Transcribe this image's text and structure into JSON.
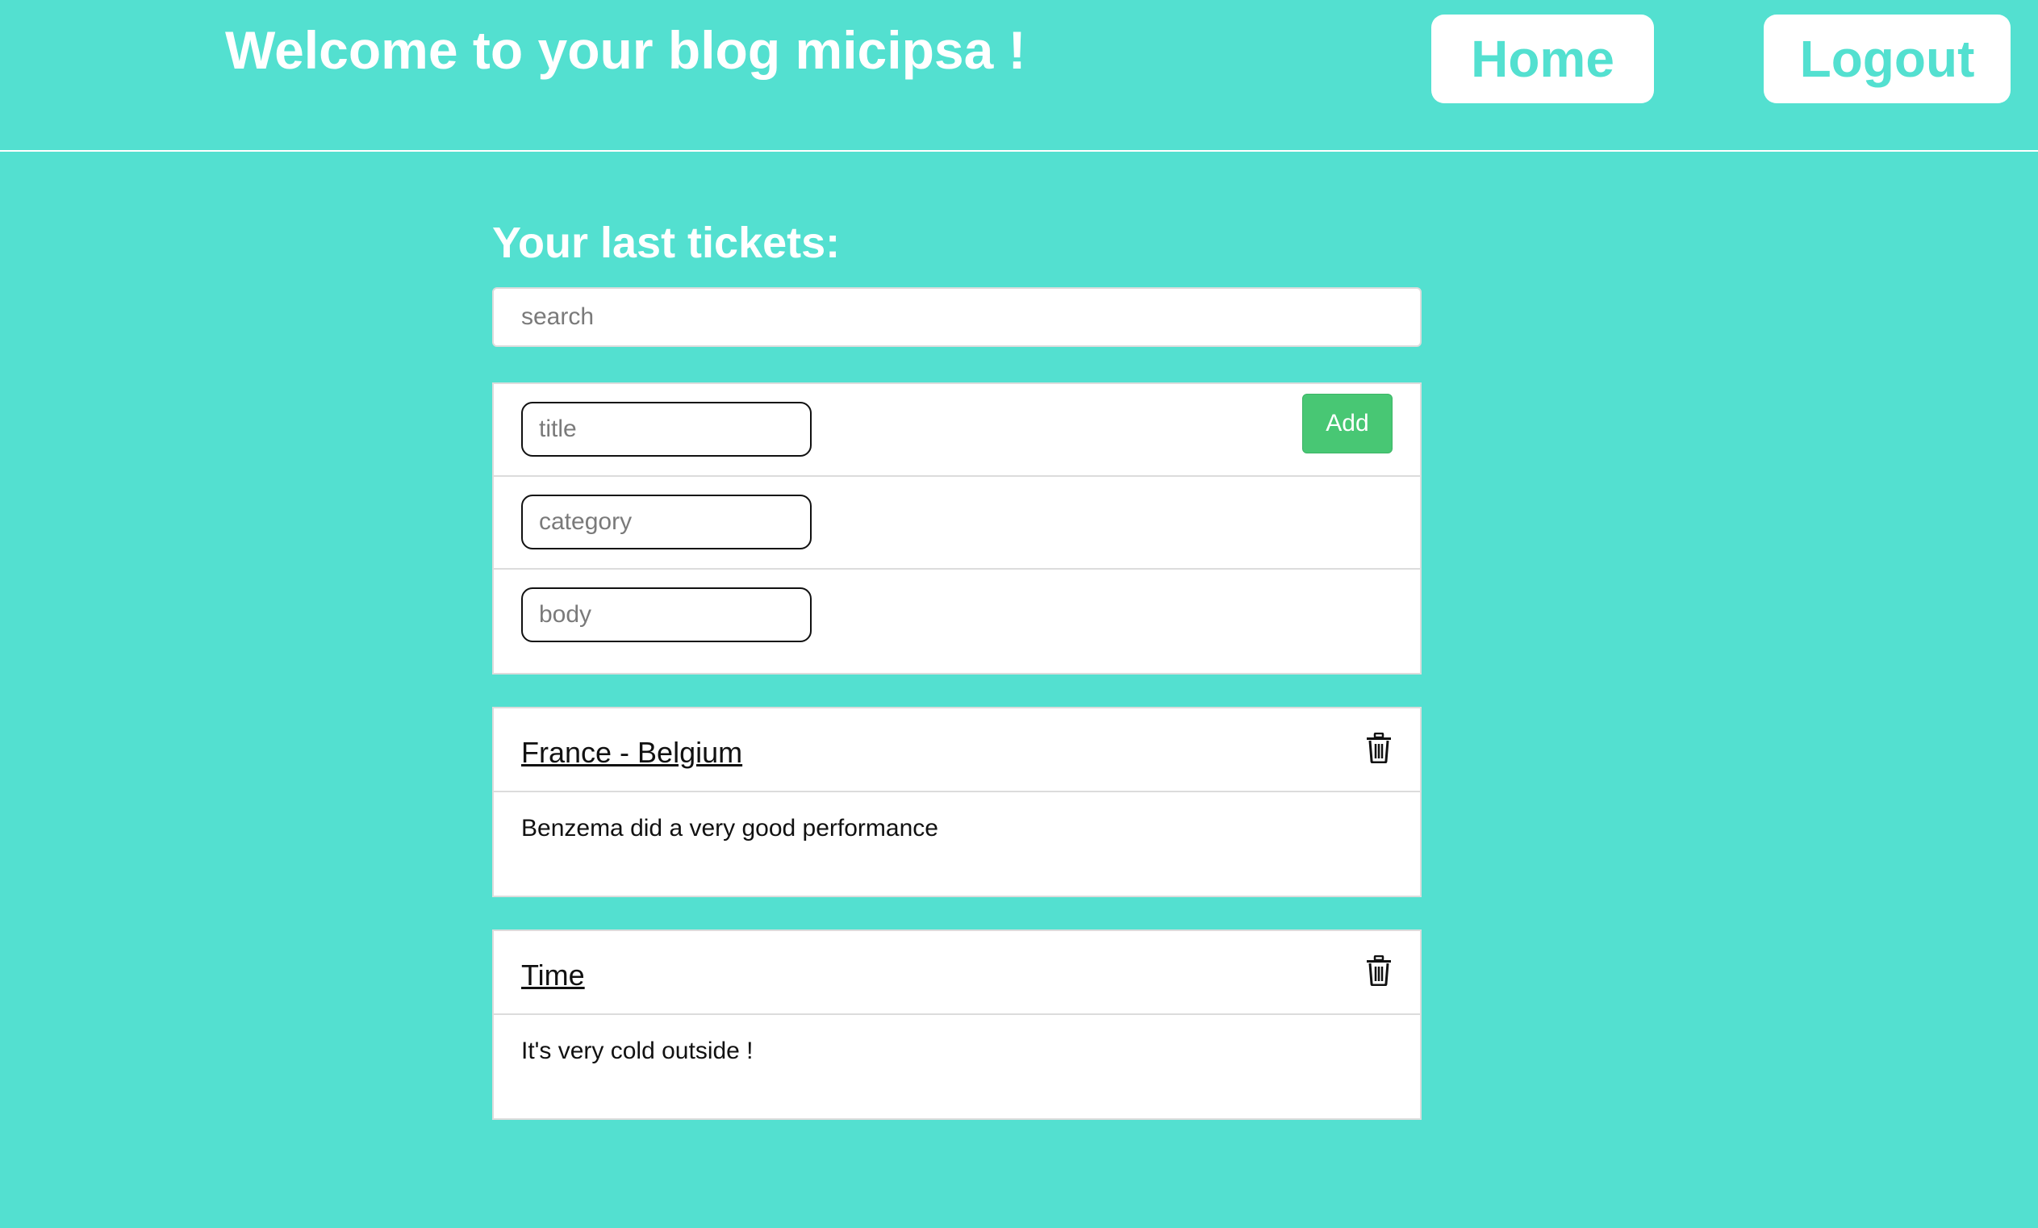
{
  "header": {
    "title": "Welcome to your blog micipsa !",
    "home_label": "Home",
    "logout_label": "Logout"
  },
  "main": {
    "section_title": "Your last tickets:",
    "search_placeholder": "search",
    "new_ticket": {
      "title_placeholder": "title",
      "category_placeholder": "category",
      "body_placeholder": "body",
      "add_label": "Add"
    },
    "tickets": [
      {
        "title": "France - Belgium",
        "body": "Benzema did a very good performance",
        "icon": "trash-icon"
      },
      {
        "title": "Time",
        "body": "It's very cold outside !",
        "icon": "trash-icon"
      }
    ]
  },
  "colors": {
    "background": "#53e0d0",
    "accent": "#53e0d0",
    "add_button": "#48c774"
  }
}
